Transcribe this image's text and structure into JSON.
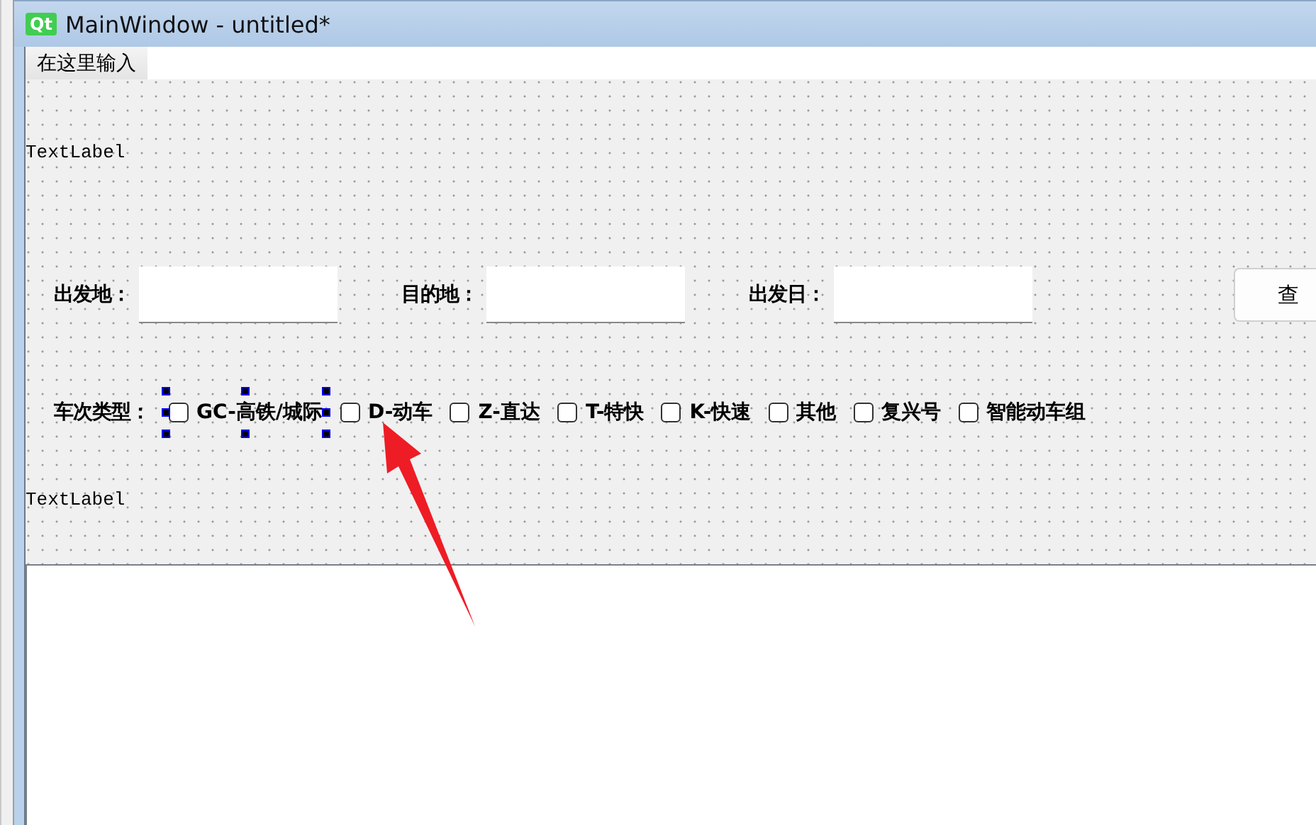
{
  "window": {
    "badge": "Qt",
    "title": "MainWindow - untitled*"
  },
  "menu_bar": {
    "items": [
      {
        "label": "在这里输入"
      }
    ]
  },
  "top_label": "TextLabel",
  "search_row": {
    "fields": [
      {
        "label": "出发地："
      },
      {
        "label": "目的地："
      },
      {
        "label": "出发日："
      }
    ],
    "button": "查"
  },
  "train_types": {
    "label": "车次类型：",
    "options": [
      {
        "label": "GC-高铁/城际",
        "checked": false,
        "selected": true
      },
      {
        "label": "D-动车",
        "checked": false,
        "selected": false
      },
      {
        "label": "Z-直达",
        "checked": false,
        "selected": false
      },
      {
        "label": "T-特快",
        "checked": false,
        "selected": false
      },
      {
        "label": "K-快速",
        "checked": false,
        "selected": false
      },
      {
        "label": "其他",
        "checked": false,
        "selected": false
      },
      {
        "label": "复兴号",
        "checked": false,
        "selected": false
      },
      {
        "label": "智能动车组",
        "checked": false,
        "selected": false
      }
    ]
  },
  "bottom_label": "TextLabel"
}
